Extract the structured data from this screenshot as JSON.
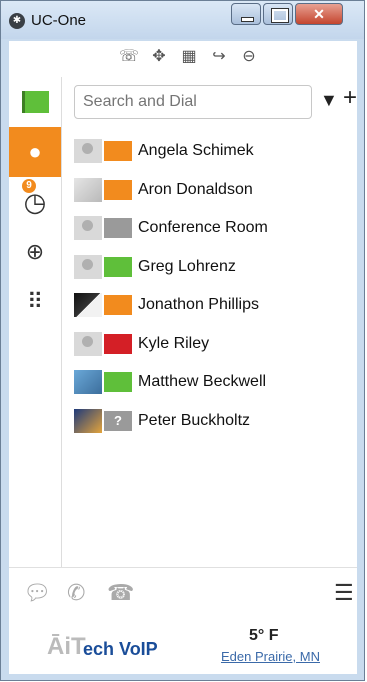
{
  "window": {
    "title": "UC-One"
  },
  "toolbar": {
    "icons": [
      "voicemail-icon",
      "move-icon",
      "building-icon",
      "call-forward-icon",
      "do-not-disturb-icon"
    ]
  },
  "nav": {
    "items": [
      {
        "name": "presence",
        "icon": "green-flag-icon"
      },
      {
        "name": "contacts",
        "icon": "person-icon",
        "active": true
      },
      {
        "name": "history",
        "icon": "history-clock-icon",
        "badge": "9"
      },
      {
        "name": "web",
        "icon": "globe-icon"
      },
      {
        "name": "dialpad",
        "icon": "dialpad-icon"
      }
    ]
  },
  "search": {
    "placeholder": "Search and Dial",
    "value": ""
  },
  "contacts": [
    {
      "name": "Angela Schimek",
      "avatar": "default",
      "status": "orange"
    },
    {
      "name": "Aron Donaldson",
      "avatar": "photo1",
      "status": "orange"
    },
    {
      "name": "Conference Room",
      "avatar": "default",
      "status": "gray"
    },
    {
      "name": "Greg Lohrenz",
      "avatar": "default",
      "status": "green"
    },
    {
      "name": "Jonathon Phillips",
      "avatar": "photo2",
      "status": "orange"
    },
    {
      "name": "Kyle Riley",
      "avatar": "default",
      "status": "red"
    },
    {
      "name": "Matthew Beckwell",
      "avatar": "photo3",
      "status": "green"
    },
    {
      "name": "Peter Buckholtz",
      "avatar": "photo4",
      "status": "unknown"
    }
  ],
  "colors": {
    "accent": "#f28b1e",
    "available": "#5fbf3a",
    "busy": "#d41f26",
    "offline": "#9a9a9a"
  },
  "footer": {
    "logo": "ech VoIP",
    "temperature": "5° F",
    "location": "Eden Prairie, MN"
  }
}
